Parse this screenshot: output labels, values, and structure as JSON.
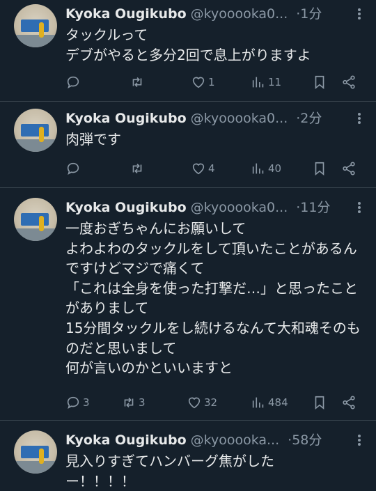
{
  "tweets": [
    {
      "name": "Kyoka Ougikubo",
      "handle": "@kyooooka0...",
      "dot": "·",
      "time": "1分",
      "text": "タックルって\nデブがやると多分2回で息上がりますよ",
      "reply_count": "",
      "retweet_count": "",
      "like_count": "1",
      "view_count": "11"
    },
    {
      "name": "Kyoka Ougikubo",
      "handle": "@kyooooka0...",
      "dot": "·",
      "time": "2分",
      "text": "肉弾です",
      "reply_count": "",
      "retweet_count": "",
      "like_count": "4",
      "view_count": "40"
    },
    {
      "name": "Kyoka Ougikubo",
      "handle": "@kyooooka0...",
      "dot": "·",
      "time": "11分",
      "text": "一度おぎちゃんにお願いして\nよわよわのタックルをして頂いたことがあるんですけどマジで痛くて\n「これは全身を使った打撃だ…」と思ったことがありまして\n15分間タックルをし続けるなんて大和魂そのものだと思いまして\n何が言いのかといいますと",
      "reply_count": "3",
      "retweet_count": "3",
      "like_count": "32",
      "view_count": "484"
    },
    {
      "name": "Kyoka Ougikubo",
      "handle": "@kyooooka...",
      "dot": "·",
      "time": "58分",
      "text": "見入りすぎてハンバーグ焦がした\nー！！！！",
      "reply_count": "",
      "retweet_count": "",
      "like_count": "",
      "view_count": ""
    }
  ],
  "icons": {
    "reply": "reply-icon",
    "retweet": "retweet-icon",
    "like": "heart-icon",
    "views": "views-icon",
    "bookmark": "bookmark-icon",
    "share": "share-icon",
    "more": "more-icon"
  },
  "colors": {
    "background": "#15202b",
    "text": "#e7e9ea",
    "secondary": "#8b98a5",
    "divider": "#38444d"
  }
}
